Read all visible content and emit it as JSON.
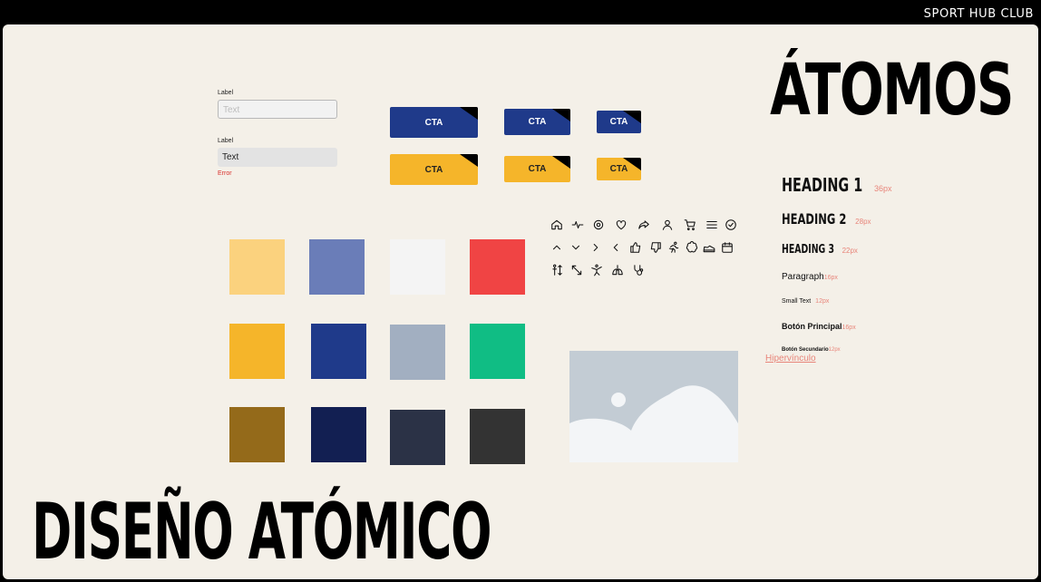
{
  "brand": "SPORT HUB CLUB",
  "titles": {
    "section": "ÁTOMOS",
    "main": "DISEÑO ATÓMICO"
  },
  "inputs": [
    {
      "label": "Label",
      "placeholder": "Text",
      "state": "default"
    },
    {
      "label": "Label",
      "value": "Text",
      "error": "Error",
      "state": "error"
    }
  ],
  "cta": {
    "label": "CTA",
    "primary_color": "#1f3a8a",
    "secondary_color": "#f5b52a"
  },
  "palette": [
    "#fbd27e",
    "#6a7db8",
    "#f4f4f4",
    "#f04444",
    "#f5b52a",
    "#1f3a8a",
    "#a2afc1",
    "#10bd84",
    "#946a1a",
    "#121f52",
    "#2b3246",
    "#333333"
  ],
  "icons": [
    "home-icon",
    "activity-icon",
    "settings-icon",
    "heart-icon",
    "share-icon",
    "user-icon",
    "cart-icon",
    "menu-icon",
    "check-circle-icon",
    "chevron-up-icon",
    "chevron-down-icon",
    "chevron-right-icon",
    "chevron-left-icon",
    "thumbs-up-icon",
    "thumbs-down-icon",
    "running-icon",
    "brain-icon",
    "shoe-icon",
    "calendar-icon",
    "height-icon",
    "expand-icon",
    "martial-arts-icon",
    "lungs-icon",
    "stethoscope-icon"
  ],
  "typography": {
    "h1": {
      "text": "HEADING 1",
      "size": "36px"
    },
    "h2": {
      "text": "HEADING 2",
      "size": "28px"
    },
    "h3": {
      "text": "HEADING 3",
      "size": "22px"
    },
    "paragraph": {
      "text": "Paragraph",
      "size": "16px"
    },
    "small": {
      "text": "Small Text",
      "size": "12px"
    },
    "primary_button": {
      "text": "Botón Principal",
      "size": "16px"
    },
    "secondary_button": {
      "text": "Botón Secundario",
      "size": "12px"
    },
    "link": {
      "text": "Hipervínculo"
    }
  }
}
